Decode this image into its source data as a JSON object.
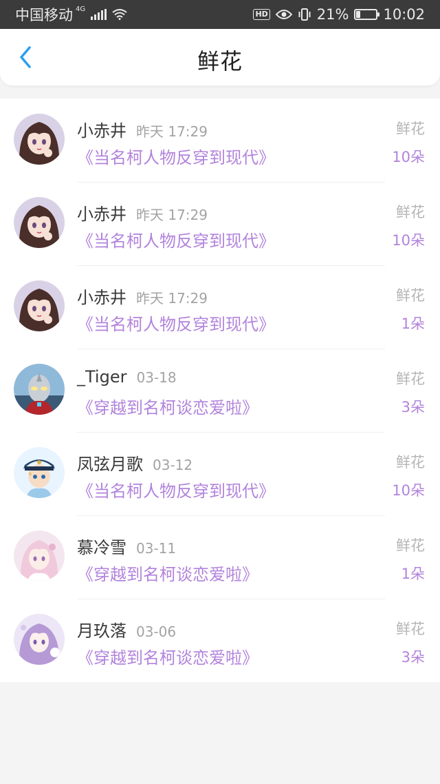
{
  "status_bar": {
    "carrier": "中国移动",
    "network": "4G",
    "battery": "21%",
    "battery_level": 0.21,
    "time": "10:02",
    "hd_badge": "HD"
  },
  "header": {
    "title": "鲜花"
  },
  "gift_label": "鲜花",
  "rows": [
    {
      "name": "小赤井",
      "time": "昨天 17:29",
      "book": "《当名柯人物反穿到现代》",
      "gift": "鲜花",
      "count": "10朵",
      "avatar": "avatar-girl-brown-hair"
    },
    {
      "name": "小赤井",
      "time": "昨天 17:29",
      "book": "《当名柯人物反穿到现代》",
      "gift": "鲜花",
      "count": "10朵",
      "avatar": "avatar-girl-brown-hair"
    },
    {
      "name": "小赤井",
      "time": "昨天 17:29",
      "book": "《当名柯人物反穿到现代》",
      "gift": "鲜花",
      "count": "1朵",
      "avatar": "avatar-girl-brown-hair"
    },
    {
      "name": "_Tiger",
      "time": "03-18",
      "book": "《穿越到名柯谈恋爱啦》",
      "gift": "鲜花",
      "count": "3朵",
      "avatar": "avatar-ultraman"
    },
    {
      "name": "凤弦月歌",
      "time": "03-12",
      "book": "《当名柯人物反穿到现代》",
      "gift": "鲜花",
      "count": "10朵",
      "avatar": "avatar-boy-police-cap"
    },
    {
      "name": "慕冷雪",
      "time": "03-11",
      "book": "《穿越到名柯谈恋爱啦》",
      "gift": "鲜花",
      "count": "1朵",
      "avatar": "avatar-pink-hair-girl"
    },
    {
      "name": "月玖落",
      "time": "03-06",
      "book": "《穿越到名柯谈恋爱啦》",
      "gift": "鲜花",
      "count": "3朵",
      "avatar": "avatar-purple-hair-girl"
    }
  ],
  "colors": {
    "accent": "#2a9ff0",
    "book_purple": "#b283dc",
    "background": "#f4f4f5"
  }
}
